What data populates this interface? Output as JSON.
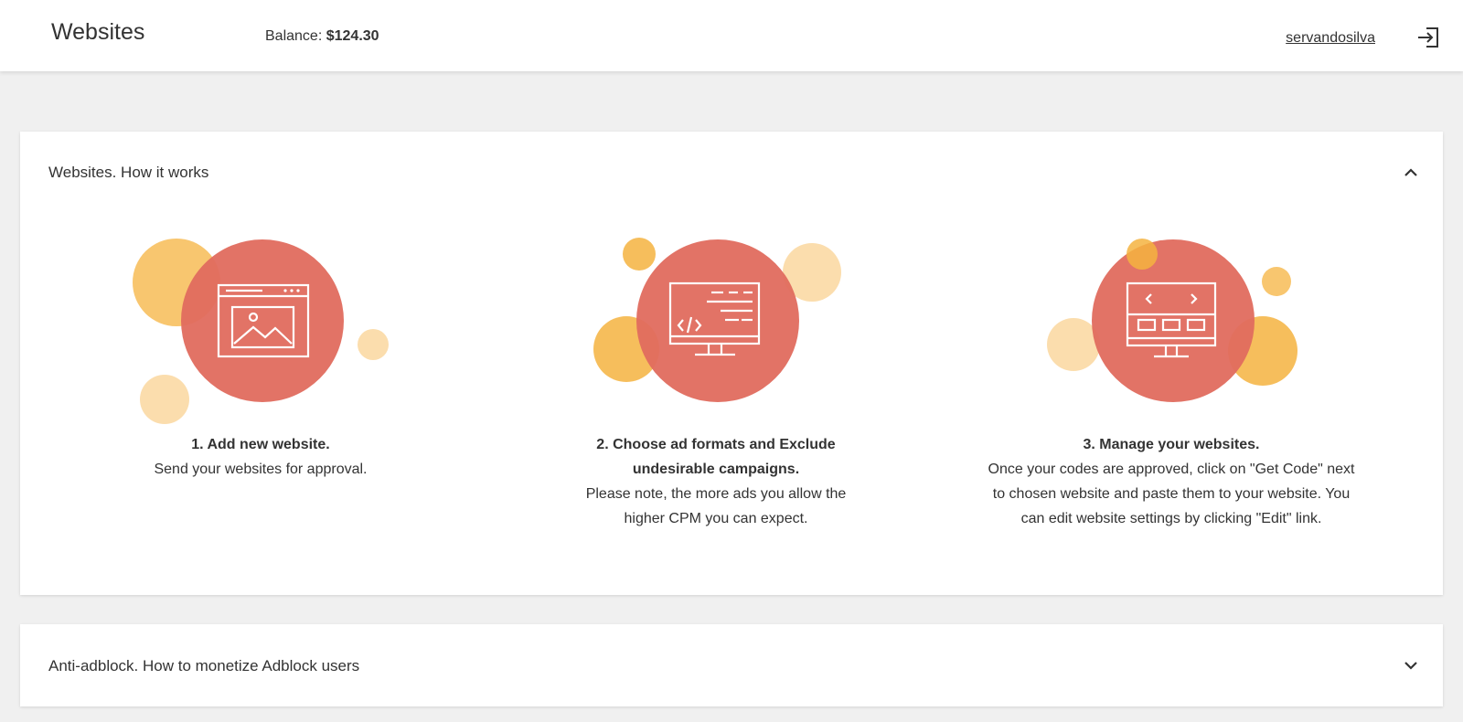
{
  "header": {
    "title": "Websites",
    "balance_label": "Balance:",
    "balance_value": "$124.30",
    "username": "servandosilva"
  },
  "colors": {
    "accent_red": "#e06b5e",
    "orange": "#f5b33f",
    "light_orange": "#fbd9a4"
  },
  "cards": [
    {
      "title": "Websites. How it works",
      "expanded": true,
      "steps": [
        {
          "title": "1. Add new website.",
          "description": "Send your websites for approval.",
          "icon": "browser-image-icon"
        },
        {
          "title": "2. Choose ad formats and Exclude undesirable campaigns.",
          "description": "Please note, the more ads you allow the higher CPM you can expect.",
          "icon": "monitor-code-icon"
        },
        {
          "title": "3. Manage your websites.",
          "description": "Once your codes are approved, click on \"Get Code\" next to chosen website and paste them to your website. You can edit website settings by clicking \"Edit\" link.",
          "icon": "monitor-slider-icon"
        }
      ]
    },
    {
      "title": "Anti-adblock. How to monetize Adblock users",
      "expanded": false
    }
  ]
}
